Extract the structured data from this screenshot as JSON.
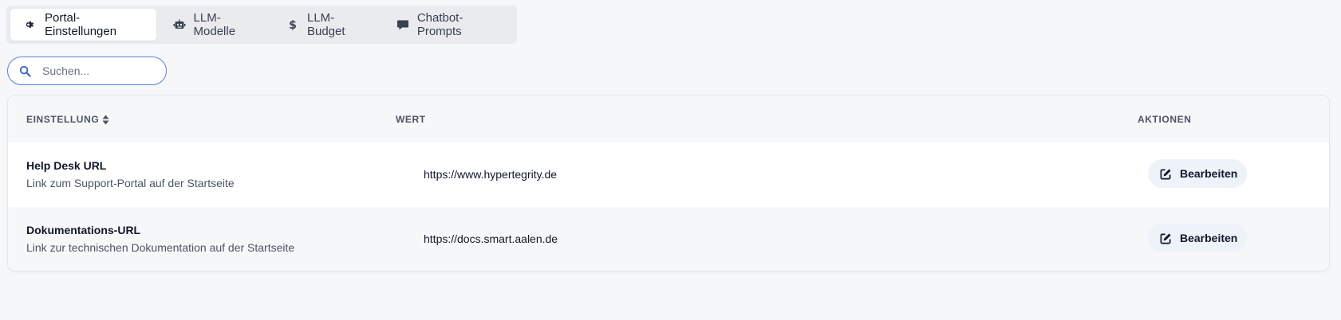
{
  "tabs": [
    {
      "label": "Portal-Einstellungen",
      "icon": "gear-icon",
      "active": true
    },
    {
      "label": "LLM-Modelle",
      "icon": "robot-icon",
      "active": false
    },
    {
      "label": "LLM-Budget",
      "icon": "dollar-icon",
      "active": false
    },
    {
      "label": "Chatbot-Prompts",
      "icon": "chat-bubble-icon",
      "active": false
    }
  ],
  "search": {
    "placeholder": "Suchen...",
    "value": ""
  },
  "table": {
    "headers": {
      "setting": "EINSTELLUNG",
      "value": "WERT",
      "actions": "AKTIONEN"
    },
    "rows": [
      {
        "title": "Help Desk URL",
        "description": "Link zum Support-Portal auf der Startseite",
        "value": "https://www.hypertegrity.de",
        "action_label": "Bearbeiten"
      },
      {
        "title": "Dokumentations-URL",
        "description": "Link zur technischen Dokumentation auf der Startseite",
        "value": "https://docs.smart.aalen.de",
        "action_label": "Bearbeiten"
      }
    ]
  },
  "colors": {
    "accent_border": "#5b7fd6",
    "page_bg": "#f6f7f9",
    "button_bg": "#eef2f9"
  }
}
